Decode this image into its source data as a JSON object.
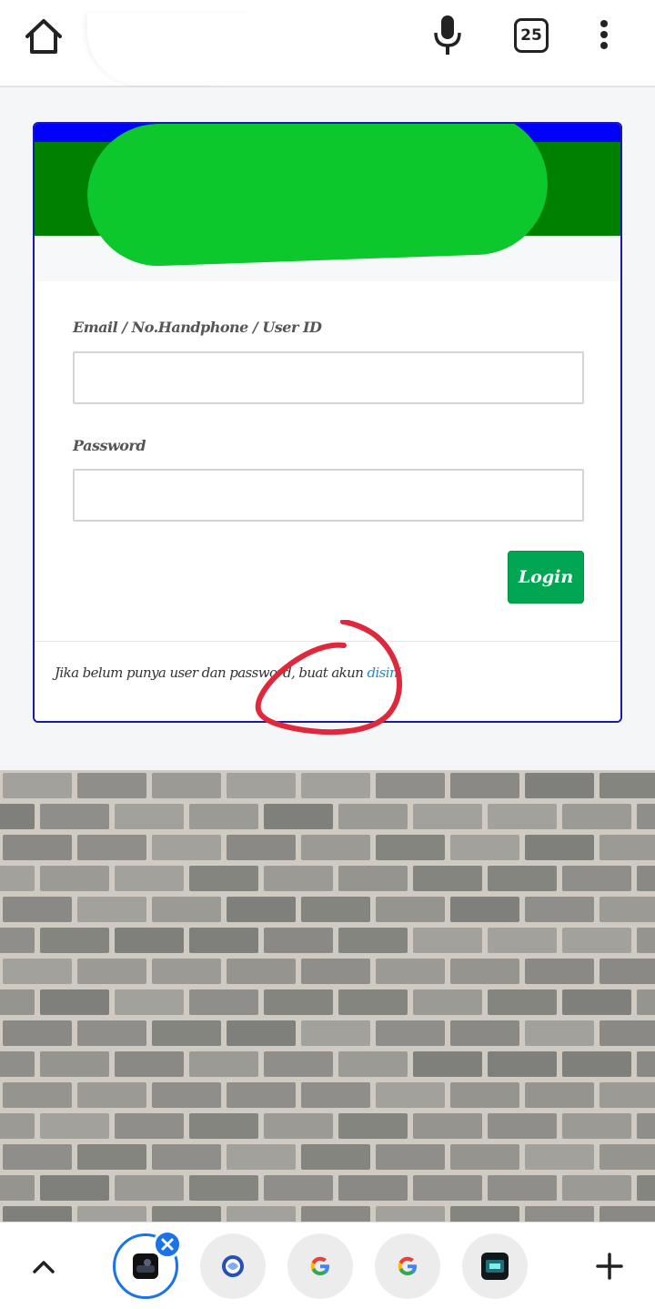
{
  "browser": {
    "tab_count": "25",
    "icons": [
      "home-icon",
      "microphone-icon",
      "tab-switcher-icon",
      "more-vert-icon"
    ]
  },
  "form": {
    "email_label": "Email / No.Handphone / User ID",
    "email_value": "",
    "password_label": "Password",
    "password_value": "",
    "login_label": "Login",
    "footer_text": "Jika belum punya user dan password, buat akun ",
    "footer_link": "disini"
  },
  "colors": {
    "header_blue": "#0000ff",
    "header_green": "#008000",
    "redaction_green": "#0cc82c",
    "login_button": "#00a651",
    "link": "#2a8ab3",
    "annotation_red": "#e0283c",
    "active_tab_ring": "#1a73e8"
  },
  "bottom_tabs": {
    "icons": [
      "chevron-up-icon",
      "tab-thumb-dark-app-icon",
      "tab-thumb-globe-icon",
      "tab-thumb-google-icon",
      "tab-thumb-google-icon",
      "tab-thumb-dark-app-icon",
      "plus-icon"
    ]
  }
}
